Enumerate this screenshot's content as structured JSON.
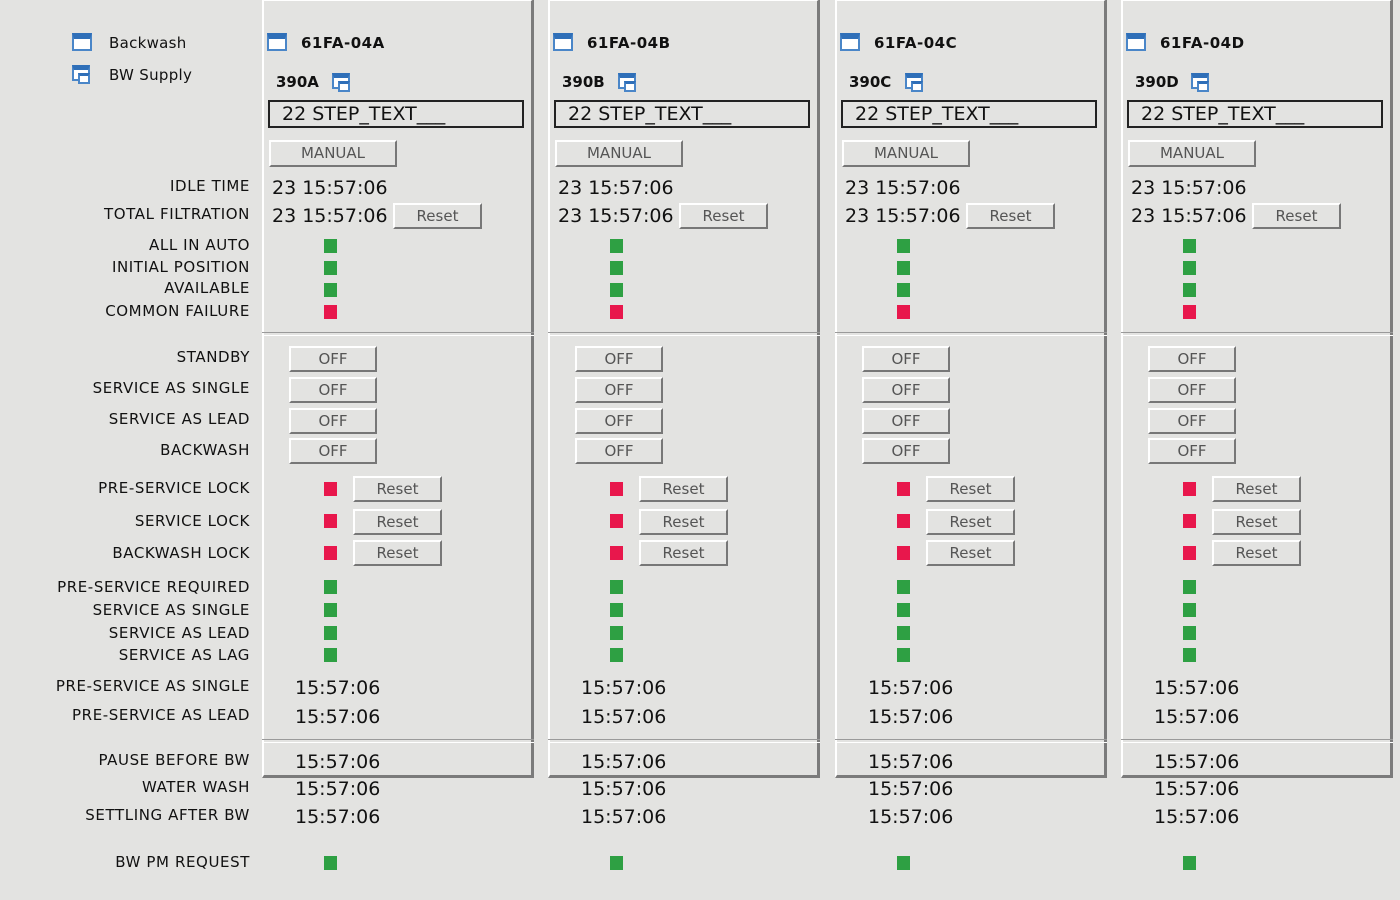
{
  "nav": [
    {
      "label": "Backwash",
      "icon": "window-icon"
    },
    {
      "label": "BW Supply",
      "icon": "window-stack-icon"
    }
  ],
  "row_labels": {
    "idle_time": "IDLE TIME",
    "total_filtration": "TOTAL FILTRATION",
    "all_in_auto": "ALL IN AUTO",
    "initial_position": "INITIAL POSITION",
    "available": "AVAILABLE",
    "common_failure": "COMMON FAILURE",
    "standby": "STANDBY",
    "service_as_single": "SERVICE AS SINGLE",
    "service_as_lead": "SERVICE AS LEAD",
    "backwash": "BACKWASH",
    "pre_service_lock": "PRE-SERVICE LOCK",
    "service_lock": "SERVICE LOCK",
    "backwash_lock": "BACKWASH LOCK",
    "pre_service_required": "PRE-SERVICE REQUIRED",
    "req_service_as_single": "SERVICE AS SINGLE",
    "req_service_as_lead": "SERVICE AS LEAD",
    "req_service_as_lag": "SERVICE AS LAG",
    "pre_service_as_single": "PRE-SERVICE AS SINGLE",
    "pre_service_as_lead": "PRE-SERVICE AS LEAD",
    "pause_before_bw": "PAUSE BEFORE BW",
    "water_wash": "WATER WASH",
    "settling_after_bw": "SETTLING AFTER BW",
    "bw_pm_request": "BW PM REQUEST"
  },
  "colors": {
    "ok": "#2ea043",
    "alarm": "#e8174c"
  },
  "filters": [
    {
      "title": "61FA-04A",
      "id": "390A",
      "step_text": "22 STEP_TEXT___",
      "mode": "MANUAL",
      "idle_time": "23 15:57:06",
      "total_filtration": "23 15:57:06",
      "reset_label": "Reset",
      "status": [
        "ok",
        "ok",
        "ok",
        "alarm"
      ],
      "switches": [
        "OFF",
        "OFF",
        "OFF",
        "OFF"
      ],
      "locks": [
        "alarm",
        "alarm",
        "alarm"
      ],
      "required": [
        "ok",
        "ok",
        "ok",
        "ok"
      ],
      "pre_service_times": [
        "15:57:06",
        "15:57:06"
      ],
      "bw_times": [
        "15:57:06",
        "15:57:06",
        "15:57:06"
      ],
      "bw_pm_request": "ok"
    },
    {
      "title": "61FA-04B",
      "id": "390B",
      "step_text": "22 STEP_TEXT___",
      "mode": "MANUAL",
      "idle_time": "23 15:57:06",
      "total_filtration": "23 15:57:06",
      "reset_label": "Reset",
      "status": [
        "ok",
        "ok",
        "ok",
        "alarm"
      ],
      "switches": [
        "OFF",
        "OFF",
        "OFF",
        "OFF"
      ],
      "locks": [
        "alarm",
        "alarm",
        "alarm"
      ],
      "required": [
        "ok",
        "ok",
        "ok",
        "ok"
      ],
      "pre_service_times": [
        "15:57:06",
        "15:57:06"
      ],
      "bw_times": [
        "15:57:06",
        "15:57:06",
        "15:57:06"
      ],
      "bw_pm_request": "ok"
    },
    {
      "title": "61FA-04C",
      "id": "390C",
      "step_text": "22 STEP_TEXT___",
      "mode": "MANUAL",
      "idle_time": "23 15:57:06",
      "total_filtration": "23 15:57:06",
      "reset_label": "Reset",
      "status": [
        "ok",
        "ok",
        "ok",
        "alarm"
      ],
      "switches": [
        "OFF",
        "OFF",
        "OFF",
        "OFF"
      ],
      "locks": [
        "alarm",
        "alarm",
        "alarm"
      ],
      "required": [
        "ok",
        "ok",
        "ok",
        "ok"
      ],
      "pre_service_times": [
        "15:57:06",
        "15:57:06"
      ],
      "bw_times": [
        "15:57:06",
        "15:57:06",
        "15:57:06"
      ],
      "bw_pm_request": "ok"
    },
    {
      "title": "61FA-04D",
      "id": "390D",
      "step_text": "22 STEP_TEXT___",
      "mode": "MANUAL",
      "idle_time": "23 15:57:06",
      "total_filtration": "23 15:57:06",
      "reset_label": "Reset",
      "status": [
        "ok",
        "ok",
        "ok",
        "alarm"
      ],
      "switches": [
        "OFF",
        "OFF",
        "OFF",
        "OFF"
      ],
      "locks": [
        "alarm",
        "alarm",
        "alarm"
      ],
      "required": [
        "ok",
        "ok",
        "ok",
        "ok"
      ],
      "pre_service_times": [
        "15:57:06",
        "15:57:06"
      ],
      "bw_times": [
        "15:57:06",
        "15:57:06",
        "15:57:06"
      ],
      "bw_pm_request": "ok"
    }
  ]
}
